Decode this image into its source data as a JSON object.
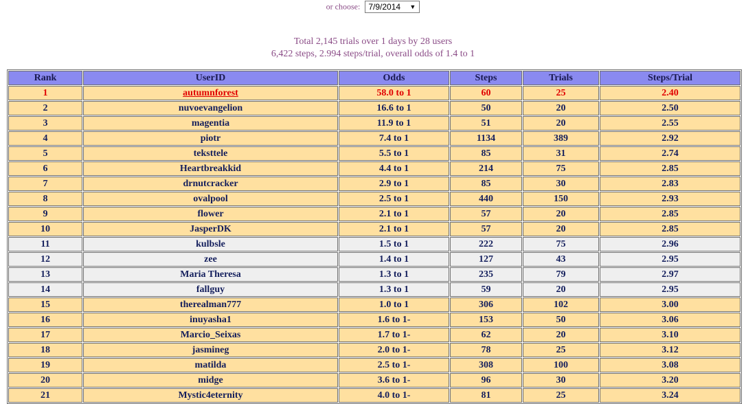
{
  "chooser": {
    "label": "or choose:",
    "selected_date": "7/9/2014"
  },
  "summary": {
    "line1": "Total 2,145 trials over 1 days by 28 users",
    "line2": "6,422 steps, 2.994 steps/trial, overall odds of 1.4 to 1"
  },
  "table": {
    "headers": [
      "Rank",
      "UserID",
      "Odds",
      "Steps",
      "Trials",
      "Steps/Trial"
    ],
    "rows": [
      {
        "rank": "1",
        "user": "autumnforest",
        "odds": "58.0 to 1",
        "steps": "60",
        "trials": "25",
        "spt": "2.40"
      },
      {
        "rank": "2",
        "user": "nuvoevangelion",
        "odds": "16.6 to 1",
        "steps": "50",
        "trials": "20",
        "spt": "2.50"
      },
      {
        "rank": "3",
        "user": "magentia",
        "odds": "11.9 to 1",
        "steps": "51",
        "trials": "20",
        "spt": "2.55"
      },
      {
        "rank": "4",
        "user": "piotr",
        "odds": "7.4 to 1",
        "steps": "1134",
        "trials": "389",
        "spt": "2.92"
      },
      {
        "rank": "5",
        "user": "teksttele",
        "odds": "5.5 to 1",
        "steps": "85",
        "trials": "31",
        "spt": "2.74"
      },
      {
        "rank": "6",
        "user": "Heartbreakkid",
        "odds": "4.4 to 1",
        "steps": "214",
        "trials": "75",
        "spt": "2.85"
      },
      {
        "rank": "7",
        "user": "drnutcracker",
        "odds": "2.9 to 1",
        "steps": "85",
        "trials": "30",
        "spt": "2.83"
      },
      {
        "rank": "8",
        "user": "ovalpool",
        "odds": "2.5 to 1",
        "steps": "440",
        "trials": "150",
        "spt": "2.93"
      },
      {
        "rank": "9",
        "user": "flower",
        "odds": "2.1 to 1",
        "steps": "57",
        "trials": "20",
        "spt": "2.85"
      },
      {
        "rank": "10",
        "user": "JasperDK",
        "odds": "2.1 to 1",
        "steps": "57",
        "trials": "20",
        "spt": "2.85"
      },
      {
        "rank": "11",
        "user": "kulbsle",
        "odds": "1.5 to 1",
        "steps": "222",
        "trials": "75",
        "spt": "2.96"
      },
      {
        "rank": "12",
        "user": "zee",
        "odds": "1.4 to 1",
        "steps": "127",
        "trials": "43",
        "spt": "2.95"
      },
      {
        "rank": "13",
        "user": "Maria Theresa",
        "odds": "1.3 to 1",
        "steps": "235",
        "trials": "79",
        "spt": "2.97"
      },
      {
        "rank": "14",
        "user": "fallguy",
        "odds": "1.3 to 1",
        "steps": "59",
        "trials": "20",
        "spt": "2.95"
      },
      {
        "rank": "15",
        "user": "therealman777",
        "odds": "1.0 to 1",
        "steps": "306",
        "trials": "102",
        "spt": "3.00"
      },
      {
        "rank": "16",
        "user": "inuyasha1",
        "odds": "1.6 to 1-",
        "steps": "153",
        "trials": "50",
        "spt": "3.06"
      },
      {
        "rank": "17",
        "user": "Marcio_Seixas",
        "odds": "1.7 to 1-",
        "steps": "62",
        "trials": "20",
        "spt": "3.10"
      },
      {
        "rank": "18",
        "user": "jasmineg",
        "odds": "2.0 to 1-",
        "steps": "78",
        "trials": "25",
        "spt": "3.12"
      },
      {
        "rank": "19",
        "user": "matilda",
        "odds": "2.5 to 1-",
        "steps": "308",
        "trials": "100",
        "spt": "3.08"
      },
      {
        "rank": "20",
        "user": "midge",
        "odds": "3.6 to 1-",
        "steps": "96",
        "trials": "30",
        "spt": "3.20"
      },
      {
        "rank": "21",
        "user": "Mystic4eternity",
        "odds": "4.0 to 1-",
        "steps": "81",
        "trials": "25",
        "spt": "3.24"
      }
    ]
  },
  "colors": {
    "header_bg": "#8a8af0",
    "row_gold": "#ffe0a0",
    "row_gray": "#efefef",
    "highlight_text": "#e00000",
    "summary_text": "#8a4b86"
  }
}
